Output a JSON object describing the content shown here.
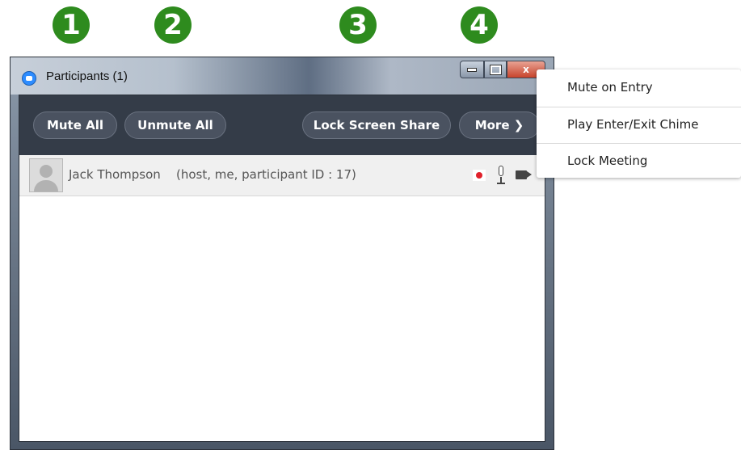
{
  "callouts": [
    "1",
    "2",
    "3",
    "4"
  ],
  "window": {
    "title": "Participants (1)",
    "controls": {
      "minimize": "",
      "maximize": "",
      "close": "x"
    }
  },
  "toolbar": {
    "mute_all": "Mute All",
    "unmute_all": "Unmute All",
    "lock_screen_share": "Lock Screen Share",
    "more": "More ❯"
  },
  "participants": [
    {
      "name": "Jack Thompson",
      "info": "(host, me, participant ID : 17)",
      "icons": [
        "record-icon",
        "microphone-icon",
        "camera-icon"
      ]
    }
  ],
  "more_menu": {
    "items": [
      "Mute on Entry",
      "Play Enter/Exit Chime",
      "Lock Meeting"
    ]
  },
  "colors": {
    "callout": "#2e8b1e",
    "toolbar": "#343c48",
    "record": "#e0202a",
    "zoom_blue": "#2d8cff"
  }
}
